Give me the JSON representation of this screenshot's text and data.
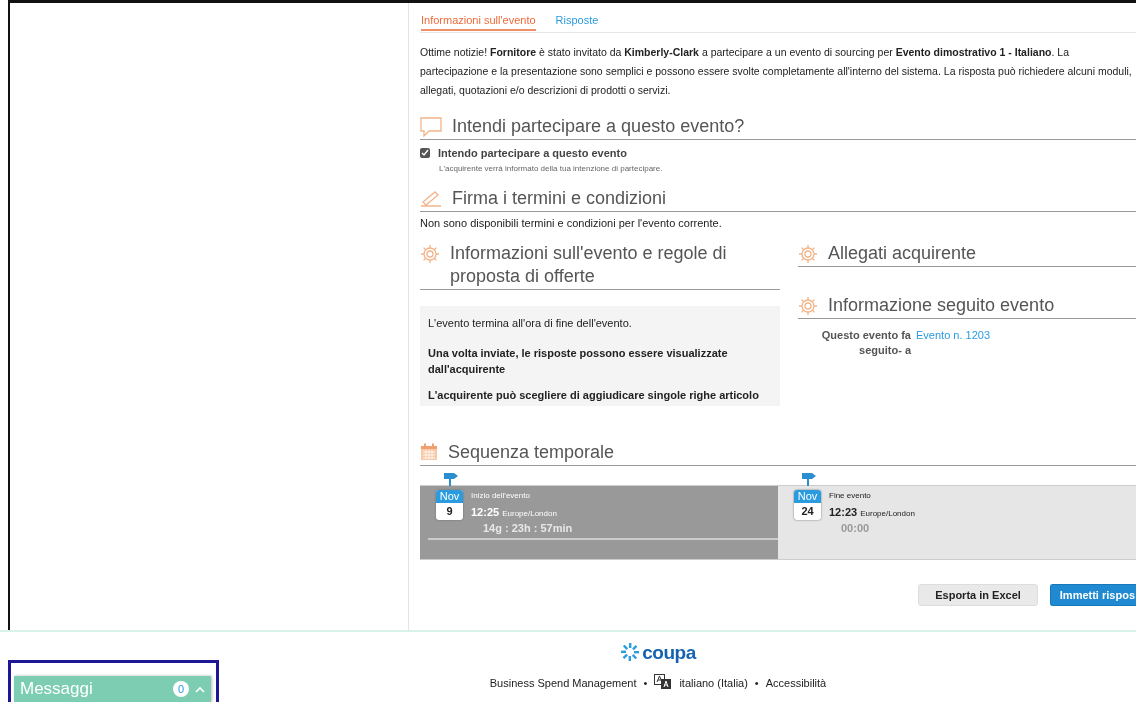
{
  "tabs": [
    {
      "label": "Informazioni sull'evento",
      "selected": true
    },
    {
      "label": "Risposte",
      "selected": false
    }
  ],
  "intro": "Ottime notizie! **Fornitore** è stato invitato da **Kimberly-Clark** a partecipare a un evento di sourcing per **Evento dimostrativo 1 - Italiano**. La partecipazione e la presentazione sono semplici e possono essere svolte completamente all'interno del sistema. La risposta può richiedere alcuni moduli, allegati, quotazioni e/o descrizioni di prodotti o servizi.",
  "participation": {
    "heading": "Intendi partecipare a questo evento?",
    "checkbox_label": "Intendo partecipare a questo evento",
    "checked": true,
    "note": "L'acquirente verrà informato della tua intenzione di partecipare."
  },
  "terms": {
    "heading": "Firma i termini e condizioni",
    "text": "Non sono disponibili termini e condizioni per l'evento corrente."
  },
  "event_rules": {
    "heading": "Informazioni sull'evento e regole di proposta di offerte",
    "rules": [
      {
        "text": "L'evento termina all'ora di fine dell'evento.",
        "bold": false
      },
      {
        "text": "Una volta inviate, le risposte possono essere visualizzate dall'acquirente",
        "bold": true
      },
      {
        "text": "L'acquirente può scegliere di aggiudicare singole righe articolo",
        "bold": true
      }
    ]
  },
  "attachments": {
    "heading": "Allegati acquirente"
  },
  "follow_up": {
    "heading": "Informazione seguito evento",
    "label": "Questo evento fa seguito- a",
    "link": "Evento n. 1203"
  },
  "timeline": {
    "heading": "Sequenza temporale",
    "events": [
      {
        "month": "Nov",
        "day": "9",
        "title": "Inizio dell'evento",
        "time": "12:25",
        "timezone": "Europe/London",
        "countdown": "14g : 23h : 57min",
        "past": true
      },
      {
        "month": "Nov",
        "day": "24",
        "title": "Fine evento",
        "time": "12:23",
        "timezone": "Europe/London",
        "countdown": "00:00",
        "past": false
      }
    ]
  },
  "buttons": [
    {
      "label": "Esporta in Excel",
      "kind": "secondary"
    },
    {
      "label": "Immetti rispos",
      "kind": "primary"
    }
  ],
  "footer": {
    "logo": "coupa",
    "items": [
      {
        "kind": "link",
        "text": "Business Spend Management"
      },
      {
        "kind": "separator",
        "text": "•"
      },
      {
        "kind": "language",
        "text": "italiano (Italia)"
      },
      {
        "kind": "separator",
        "text": "•"
      },
      {
        "kind": "link",
        "text": "Accessibilità"
      }
    ]
  },
  "messages": {
    "label": "Messaggi",
    "count": "0"
  }
}
